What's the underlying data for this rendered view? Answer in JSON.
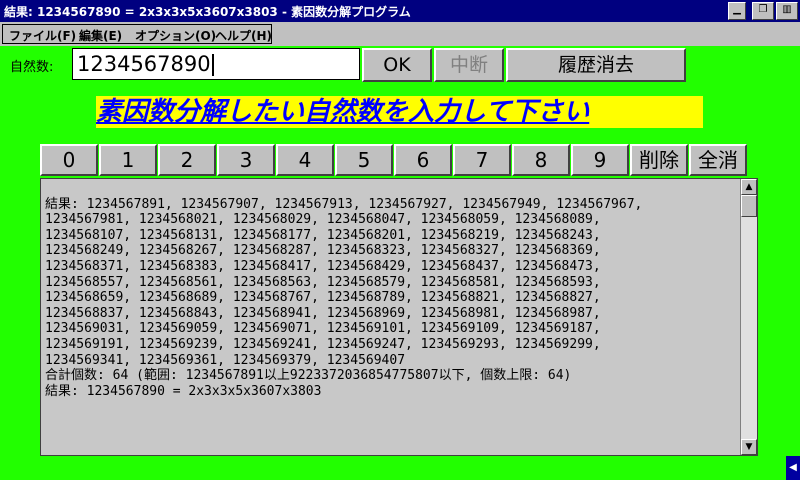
{
  "window": {
    "title": "結果: 1234567890 = 2x3x3x5x3607x3803 - 素因数分解プログラム"
  },
  "menu": {
    "items": [
      "ファイル(F)",
      "編集(E)",
      "オプション(O)",
      "ヘルプ(H)"
    ]
  },
  "input": {
    "label": "自然数:",
    "value": "1234567890"
  },
  "buttons": {
    "ok": "OK",
    "stop": "中断",
    "clear_history": "履歴消去"
  },
  "headline": "素因数分解したい自然数を入力して下さい",
  "keypad": [
    "0",
    "1",
    "2",
    "3",
    "4",
    "5",
    "6",
    "7",
    "8",
    "9",
    "削除",
    "全消"
  ],
  "output": {
    "lines": [
      "結果: 1234567891, 1234567907, 1234567913, 1234567927, 1234567949, 1234567967,",
      "1234567981, 1234568021, 1234568029, 1234568047, 1234568059, 1234568089,",
      "1234568107, 1234568131, 1234568177, 1234568201, 1234568219, 1234568243,",
      "1234568249, 1234568267, 1234568287, 1234568323, 1234568327, 1234568369,",
      "1234568371, 1234568383, 1234568417, 1234568429, 1234568437, 1234568473,",
      "1234568557, 1234568561, 1234568563, 1234568579, 1234568581, 1234568593,",
      "1234568659, 1234568689, 1234568767, 1234568789, 1234568821, 1234568827,",
      "1234568837, 1234568843, 1234568941, 1234568969, 1234568981, 1234568987,",
      "1234569031, 1234569059, 1234569071, 1234569101, 1234569109, 1234569187,",
      "1234569191, 1234569239, 1234569241, 1234569247, 1234569293, 1234569299,",
      "1234569341, 1234569361, 1234569379, 1234569407",
      "合計個数: 64 (範囲: 1234567891以上9223372036854775807以下, 個数上限: 64)",
      "結果: 1234567890 = 2x3x3x5x3607x3803"
    ]
  },
  "colors": {
    "background": "#22ff00",
    "titlebar": "#000080",
    "headline_bg": "#ffff00",
    "headline_text": "#0000ff"
  }
}
